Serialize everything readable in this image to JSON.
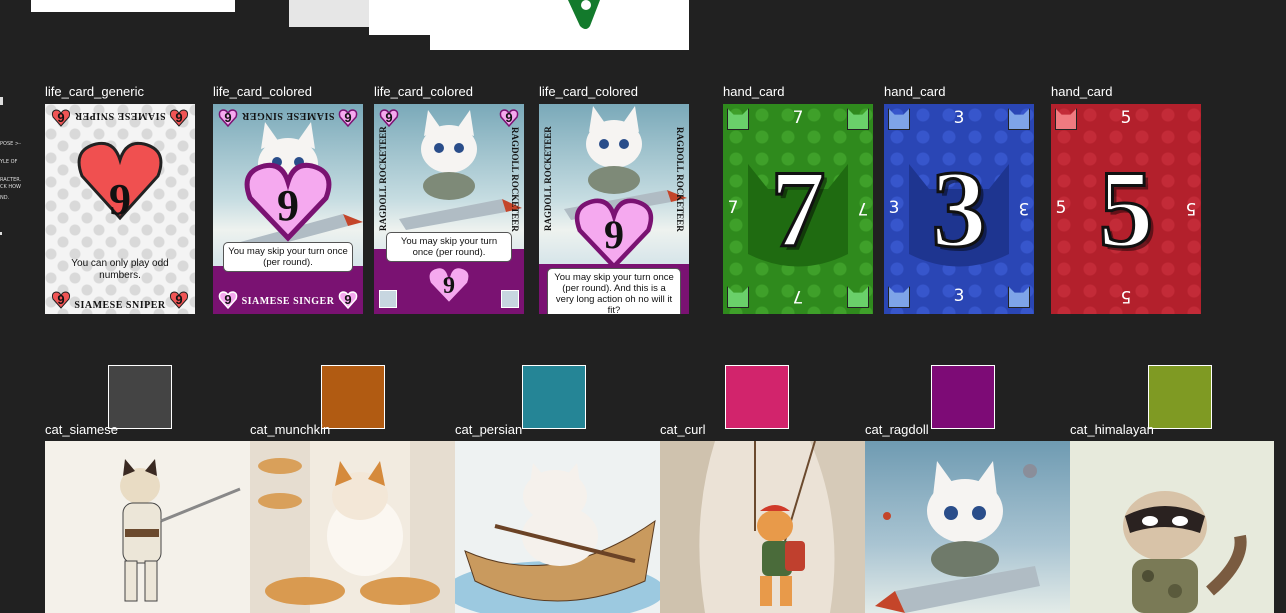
{
  "top_header": {
    "partial_mark": ""
  },
  "left_notes": [
    "POSE >-",
    "YLE OF",
    "RACTER.",
    "ND.",
    "",
    "",
    "CK HOW"
  ],
  "life_cards": [
    {
      "label": "life_card_generic",
      "kind": "generic",
      "number": "9",
      "title": "SIAMESE SNIPER",
      "title_flipped": "SIAMESE SNIPER",
      "text": "You can only play odd numbers."
    },
    {
      "label": "life_card_colored",
      "kind": "colored",
      "number": "9",
      "title": "SIAMESE SINGER",
      "title_flipped": "SIAMESE SINGER",
      "text": "You may skip your turn once (per round)."
    },
    {
      "label": "life_card_colored",
      "kind": "colored",
      "number": "9",
      "title": "RAGDOLL ROCKETEER",
      "text": "You may skip your turn once (per round)."
    },
    {
      "label": "life_card_colored",
      "kind": "colored",
      "number": "9",
      "title": "RAGDOLL ROCKETEER",
      "text": "You may skip your turn once (per round). And this is a very long action oh no will it fit?"
    }
  ],
  "hand_cards": [
    {
      "label": "hand_card",
      "number": "7",
      "color": "#2f8a1d",
      "pattern": "#3fa02a",
      "shape": "#1f6b11"
    },
    {
      "label": "hand_card",
      "number": "3",
      "color": "#2a46b5",
      "pattern": "#3756cc",
      "shape": "#1e3590"
    },
    {
      "label": "hand_card",
      "number": "5",
      "color": "#b3202c",
      "pattern": "#c32b38",
      "shape": "#8e1620"
    }
  ],
  "cats": [
    {
      "label": "cat_siamese",
      "color": "#444444",
      "bg": "#f4f1ea"
    },
    {
      "label": "cat_munchkin",
      "color": "#b15b12",
      "bg": "#f2ebe0"
    },
    {
      "label": "cat_persian",
      "color": "#258596",
      "bg": "#eef2f2"
    },
    {
      "label": "cat_curl",
      "color": "#d2246c",
      "bg": "#ebe2d6"
    },
    {
      "label": "cat_ragdoll",
      "color": "#7d0b76",
      "bg": "#8fb2c6"
    },
    {
      "label": "cat_himalayan",
      "color": "#7f9a23",
      "bg": "#e7eadc"
    }
  ]
}
